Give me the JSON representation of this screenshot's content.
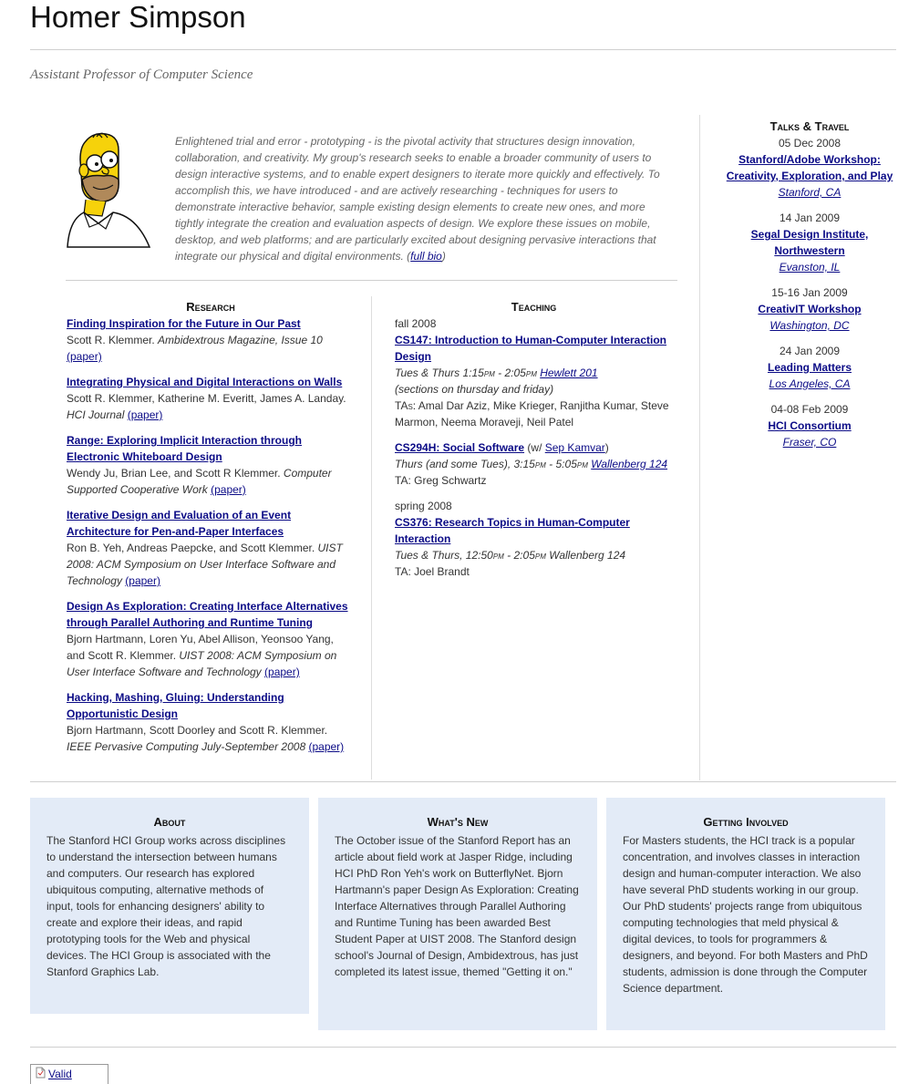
{
  "header": {
    "name": "Homer Simpson",
    "subtitle": "Assistant Professor of Computer Science"
  },
  "intro": {
    "bio_text": "Enlightened trial and error - prototyping - is the pivotal activity that structures design innovation, collaboration, and creativity. My group's research seeks to enable a broader community of users to design interactive systems, and to enable expert designers to iterate more quickly and effectively. To accomplish this, we have introduced - and are actively researching - techniques for users to demonstrate interactive behavior, sample existing design elements to create new ones, and more tightly integrate the creation and evaluation aspects of design. We explore these issues on mobile, desktop, and web platforms; and are particularly excited about designing pervasive interactions that integrate our physical and digital environments.",
    "full_bio_link": "full bio",
    "avatar_icon": "homer-simpson-portrait"
  },
  "research": {
    "heading": "Research",
    "items": [
      {
        "title": "Finding Inspiration for the Future in Our Past",
        "authors": "Scott R. Klemmer.",
        "venue": "Ambidextrous Magazine, Issue 10",
        "link": "(paper)"
      },
      {
        "title": "Integrating Physical and Digital Interactions on Walls",
        "authors": "Scott R. Klemmer, Katherine M. Everitt, James A. Landay.",
        "venue": "HCI Journal",
        "link": "(paper)"
      },
      {
        "title": "Range: Exploring Implicit Interaction through Electronic Whiteboard Design",
        "authors": "Wendy Ju, Brian Lee, and Scott R Klemmer.",
        "venue": "Computer Supported Cooperative Work",
        "link": "(paper)"
      },
      {
        "title": "Iterative Design and Evaluation of an Event Architecture for Pen-and-Paper Interfaces",
        "authors": "Ron B. Yeh, Andreas Paepcke, and Scott Klemmer.",
        "venue": "UIST 2008: ACM Symposium on User Interface Software and Technology",
        "link": "(paper)"
      },
      {
        "title": "Design As Exploration: Creating Interface Alternatives through Parallel Authoring and Runtime Tuning",
        "authors": "Bjorn Hartmann, Loren Yu, Abel Allison, Yeonsoo Yang, and Scott R. Klemmer.",
        "venue": "UIST 2008: ACM Symposium on User Interface Software and Technology",
        "link": "(paper)"
      },
      {
        "title": "Hacking, Mashing, Gluing: Understanding Opportunistic Design",
        "authors": "Bjorn Hartmann, Scott Doorley and Scott R. Klemmer.",
        "venue": "IEEE Pervasive Computing July-September 2008",
        "link": "(paper)"
      }
    ]
  },
  "teaching": {
    "heading": "Teaching",
    "fall_label": "fall 2008",
    "spring_label": "spring 2008",
    "cs147": {
      "title": "CS147: Introduction to Human-Computer Interaction Design",
      "days": "Tues & Thurs 1:15",
      "pm1": "pm",
      "to": " - 2:05",
      "pm2": "pm",
      "room": "Hewlett 201",
      "sections": "(sections on thursday and friday)",
      "tas_label": "TAs:",
      "tas": "Amal Dar Aziz, Mike Krieger, Ranjitha Kumar, Steve Marmon, Neema Moraveji, Neil Patel"
    },
    "cs294h": {
      "title": "CS294H: Social Software",
      "with_prefix": "(w/",
      "with_name": "Sep Kamvar",
      "with_suffix": ")",
      "days": "Thurs (and some Tues), 3:15",
      "pm1": "pm",
      "to": " - 5:05",
      "pm2": "pm",
      "room": "Wallenberg 124",
      "ta_label": "TA:",
      "ta": "Greg Schwartz"
    },
    "cs376": {
      "title": "CS376: Research Topics in Human-Computer Interaction",
      "days": "Tues & Thurs, 12:50",
      "pm1": "pm",
      "to": " - 2:05",
      "pm2": "pm",
      "room": " Wallenberg 124",
      "ta_label": "TA:",
      "ta": "Joel Brandt"
    }
  },
  "talks": {
    "heading": "Talks & Travel",
    "items": [
      {
        "date": "05 Dec 2008",
        "title": "Stanford/Adobe Workshop: Creativity, Exploration, and Play",
        "place": "Stanford, CA"
      },
      {
        "date": "14 Jan 2009",
        "title": "Segal Design Institute, Northwestern",
        "place": "Evanston, IL"
      },
      {
        "date": "15-16 Jan 2009",
        "title": "CreativIT Workshop",
        "place": "Washington, DC"
      },
      {
        "date": "24 Jan 2009",
        "title": "Leading Matters",
        "place": "Los Angeles, CA"
      },
      {
        "date": "04-08 Feb 2009",
        "title": "HCI Consortium",
        "place": "Fraser, CO"
      }
    ]
  },
  "boxes": {
    "about": {
      "heading": "About",
      "text": "The Stanford HCI Group works across disciplines to understand the intersection between humans and computers. Our research has explored ubiquitous computing, alternative methods of input, tools for enhancing designers' ability to create and explore their ideas, and rapid prototyping tools for the Web and physical devices. The HCI Group is associated with the Stanford Graphics Lab."
    },
    "news": {
      "heading": "What's New",
      "text": "The October issue of the Stanford Report has an article about field work at Jasper Ridge, including HCI PhD Ron Yeh's work on ButterflyNet. Bjorn Hartmann's paper Design As Exploration: Creating Interface Alternatives through Parallel Authoring and Runtime Tuning has been awarded Best Student Paper at UIST 2008. The Stanford design school's Journal of Design, Ambidextrous, has just completed its latest issue, themed \"Getting it on.\""
    },
    "involved": {
      "heading": "Getting Involved",
      "text": "For Masters students, the HCI track is a popular concentration, and involves classes in interaction design and human-computer interaction. We also have several PhD students working in our group. Our PhD students' projects range from ubiquitous computing technologies that meld physical & digital devices, to tools for programmers & designers, and beyond. For both Masters and PhD students, admission is done through the Computer Science department."
    }
  },
  "footer": {
    "valid_label": "Valid",
    "badge_icon": "document-icon"
  },
  "colors": {
    "link": "#0b0b86",
    "box_bg": "#e3ebf7",
    "intro_text": "#666666"
  }
}
